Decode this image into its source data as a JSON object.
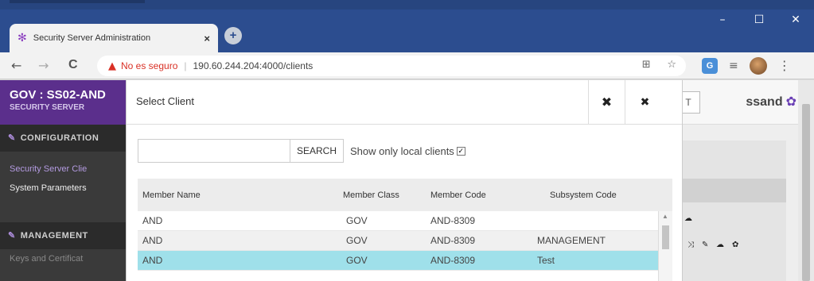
{
  "browser": {
    "tab_title": "Security Server Administration",
    "tab_close": "×",
    "new_tab": "+",
    "window_buttons": [
      "–",
      "☐",
      "✕"
    ],
    "nav_back": "←",
    "nav_forward": "→",
    "nav_reload": "C",
    "insecure_label": "No es seguro",
    "url": "190.60.244.204:4000/clients"
  },
  "app": {
    "brand_title": "GOV : SS02-AND",
    "brand_subtitle": "SECURITY SERVER",
    "user_name": "ssand",
    "top_button": "T",
    "sidebar": {
      "configuration_header": "CONFIGURATION",
      "items": [
        {
          "label": "Security Server Clie"
        },
        {
          "label": "System Parameters"
        }
      ],
      "management_header": "MANAGEMENT",
      "management_items": [
        {
          "label": "Keys and Certificat"
        }
      ]
    }
  },
  "modal": {
    "title": "Select Client",
    "close_primary": "✖",
    "close_secondary": "✖",
    "search": {
      "value": "",
      "button_label": "SEARCH",
      "local_label": "Show only local clients",
      "local_checked": "✓"
    },
    "table": {
      "headers": [
        "Member Name",
        "Member Class",
        "Member Code",
        "Subsystem Code"
      ],
      "rows": [
        {
          "name": "AND",
          "class": "GOV",
          "code": "AND-8309",
          "subsystem": ""
        },
        {
          "name": "AND",
          "class": "GOV",
          "code": "AND-8309",
          "subsystem": "MANAGEMENT"
        },
        {
          "name": "AND",
          "class": "GOV",
          "code": "AND-8309",
          "subsystem": "Test"
        }
      ]
    }
  },
  "colors": {
    "brand_purple": "#5b2f8c",
    "selected_row": "#9fe0ea",
    "chrome_blue": "#2c4d8f"
  }
}
